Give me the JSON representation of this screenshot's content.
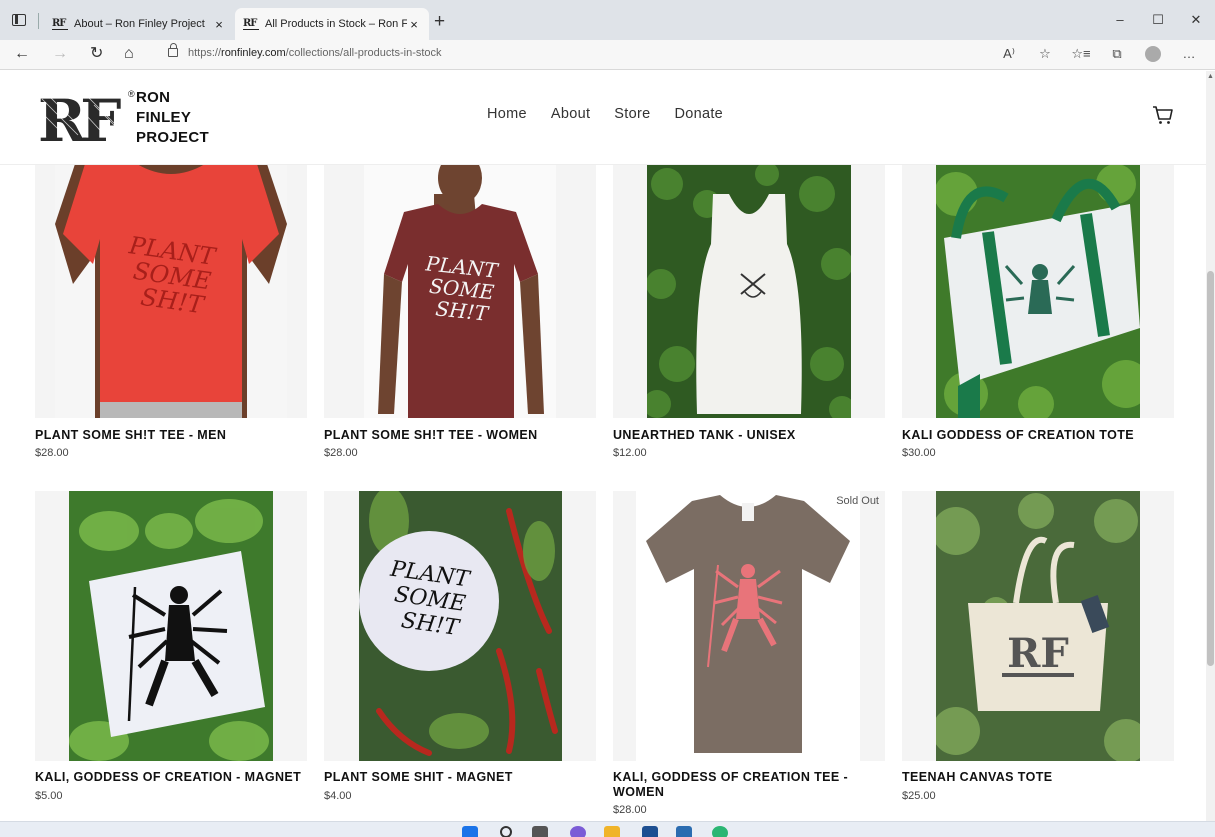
{
  "browser": {
    "tabs": [
      {
        "favicon": "RF",
        "title": "About – Ron Finley Project",
        "active": false
      },
      {
        "favicon": "RF",
        "title": "All Products in Stock – Ron Finley",
        "active": true
      }
    ],
    "new_tab": "+",
    "close": "×",
    "url_prefix": "https://",
    "url_host": "ronfinley.com",
    "url_path": "/collections/all-products-in-stock",
    "window_controls": [
      "–",
      "☐",
      "✕"
    ],
    "nav": {
      "back": "←",
      "forward": "→",
      "reload": "↻",
      "home": "⌂"
    },
    "toolbar_icons": [
      "A⁾",
      "☆",
      "☆≡",
      "⧉",
      "…"
    ]
  },
  "site": {
    "logo_mark": "RF",
    "logo_lines": [
      "RON",
      "FINLEY",
      "PROJECT"
    ],
    "nav": [
      "Home",
      "About",
      "Store",
      "Donate"
    ]
  },
  "products": [
    {
      "title": "PLANT SOME SH!T TEE - MEN",
      "price": "$28.00",
      "sold_out": ""
    },
    {
      "title": "PLANT SOME SH!T TEE - WOMEN",
      "price": "$28.00",
      "sold_out": ""
    },
    {
      "title": "UNEARTHED TANK - UNISEX",
      "price": "$12.00",
      "sold_out": ""
    },
    {
      "title": "KALI GODDESS OF CREATION TOTE",
      "price": "$30.00",
      "sold_out": ""
    },
    {
      "title": "KALI, GODDESS OF CREATION - MAGNET",
      "price": "$5.00",
      "sold_out": ""
    },
    {
      "title": "PLANT SOME SHIT - MAGNET",
      "price": "$4.00",
      "sold_out": ""
    },
    {
      "title": "KALI, GODDESS OF CREATION TEE - WOMEN",
      "price": "$28.00",
      "sold_out": "Sold Out"
    },
    {
      "title": "TEENAH CANVAS TOTE",
      "price": "$25.00",
      "sold_out": ""
    }
  ],
  "colors": {
    "red_tee": "#e8443a",
    "maroon_tee": "#7a2e2e",
    "foliage": "#2f5a22",
    "tote_green": "#1a7a4a",
    "brown_tee": "#7b6d63",
    "kali_pink": "#e8747a"
  }
}
